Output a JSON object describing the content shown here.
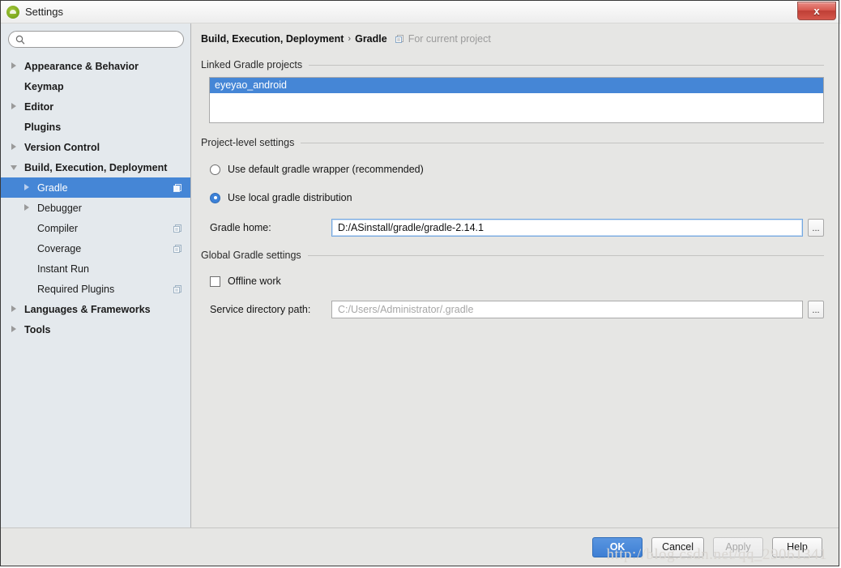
{
  "window": {
    "title": "Settings",
    "app_icon": "android-logo-icon",
    "close_label": "x"
  },
  "search": {
    "value": "",
    "placeholder": "",
    "icon": "search-icon"
  },
  "sidebar": {
    "items": [
      {
        "label": "Appearance & Behavior",
        "arrow": "closed",
        "depth": 0,
        "bold": true,
        "badge": false,
        "selected": false
      },
      {
        "label": "Keymap",
        "arrow": "none",
        "depth": 0,
        "bold": true,
        "badge": false,
        "selected": false
      },
      {
        "label": "Editor",
        "arrow": "closed",
        "depth": 0,
        "bold": true,
        "badge": false,
        "selected": false
      },
      {
        "label": "Plugins",
        "arrow": "none",
        "depth": 0,
        "bold": true,
        "badge": false,
        "selected": false
      },
      {
        "label": "Version Control",
        "arrow": "closed",
        "depth": 0,
        "bold": true,
        "badge": false,
        "selected": false
      },
      {
        "label": "Build, Execution, Deployment",
        "arrow": "open",
        "depth": 0,
        "bold": true,
        "badge": false,
        "selected": false
      },
      {
        "label": "Gradle",
        "arrow": "closed",
        "depth": 1,
        "bold": false,
        "badge": true,
        "selected": true
      },
      {
        "label": "Debugger",
        "arrow": "closed",
        "depth": 1,
        "bold": false,
        "badge": false,
        "selected": false
      },
      {
        "label": "Compiler",
        "arrow": "none",
        "depth": 1,
        "bold": false,
        "badge": true,
        "selected": false
      },
      {
        "label": "Coverage",
        "arrow": "none",
        "depth": 1,
        "bold": false,
        "badge": true,
        "selected": false
      },
      {
        "label": "Instant Run",
        "arrow": "none",
        "depth": 1,
        "bold": false,
        "badge": false,
        "selected": false
      },
      {
        "label": "Required Plugins",
        "arrow": "none",
        "depth": 1,
        "bold": false,
        "badge": true,
        "selected": false
      },
      {
        "label": "Languages & Frameworks",
        "arrow": "closed",
        "depth": 0,
        "bold": true,
        "badge": false,
        "selected": false
      },
      {
        "label": "Tools",
        "arrow": "closed",
        "depth": 0,
        "bold": true,
        "badge": false,
        "selected": false
      }
    ]
  },
  "breadcrumb": {
    "root": "Build, Execution, Deployment",
    "separator": "›",
    "leaf": "Gradle",
    "scope_icon": "project-scope-icon",
    "scope_text": "For current project"
  },
  "linked_projects": {
    "group_label": "Linked Gradle projects",
    "items": [
      {
        "label": "eyeyao_android",
        "selected": true
      }
    ]
  },
  "project_level": {
    "group_label": "Project-level settings",
    "radios": [
      {
        "label": "Use default gradle wrapper (recommended)",
        "selected": false
      },
      {
        "label": "Use local gradle distribution",
        "selected": true
      }
    ],
    "gradle_home": {
      "label": "Gradle home:",
      "value": "D:/ASinstall/gradle/gradle-2.14.1",
      "placeholder": "",
      "browse_label": "...",
      "focused": true
    }
  },
  "global_settings": {
    "group_label": "Global Gradle settings",
    "offline": {
      "label": "Offline work",
      "checked": false
    },
    "service_dir": {
      "label": "Service directory path:",
      "value": "",
      "placeholder": "C:/Users/Administrator/.gradle",
      "browse_label": "..."
    }
  },
  "footer": {
    "ok": "OK",
    "cancel": "Cancel",
    "apply": "Apply",
    "help": "Help",
    "watermark": "http://blog.csdn.net/qq_29061341"
  },
  "colors": {
    "accent": "#4586d6",
    "sidebar_bg": "#e4e9ed",
    "panel_bg": "#e6e6e4",
    "focus_border": "#73a7e0"
  }
}
